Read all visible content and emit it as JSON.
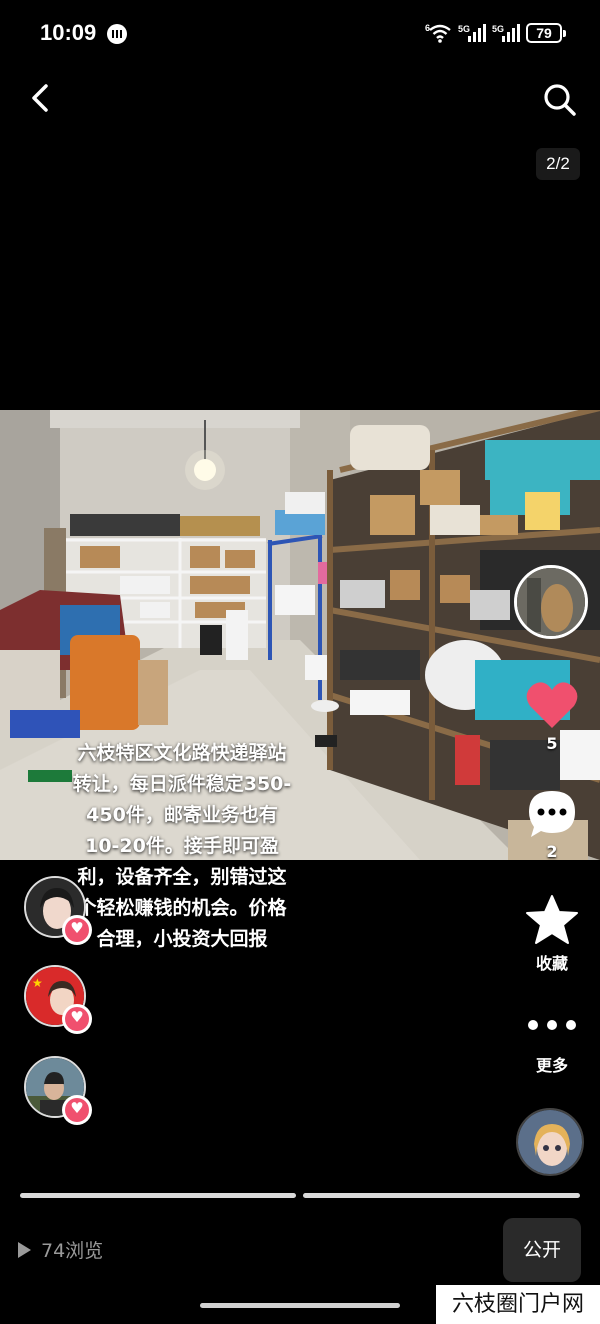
{
  "status_bar": {
    "time": "10:09",
    "wifi_label": "6",
    "signal1_label": "5G",
    "signal2_label": "5G",
    "battery": "79"
  },
  "top_bar": {
    "back_icon": "chevron-left-icon",
    "search_icon": "search-icon",
    "page_indicator": "2/2"
  },
  "post": {
    "caption": "六枝特区文化路快递驿站转让，每日派件稳定350-450件，邮寄业务也有10-20件。接手即可盈利，设备齐全，别错过这个轻松赚钱的机会。价格合理，小投资大回报"
  },
  "actions": {
    "like_count": "5",
    "comment_count": "2",
    "favorite_label": "收藏",
    "more_label": "更多"
  },
  "progress": {
    "segments": 2,
    "current": 2
  },
  "footer": {
    "views": "74浏览",
    "visibility_button": "公开"
  },
  "watermark": "六枝圈门户网",
  "colors": {
    "like": "#f0506e",
    "background": "#000000"
  }
}
